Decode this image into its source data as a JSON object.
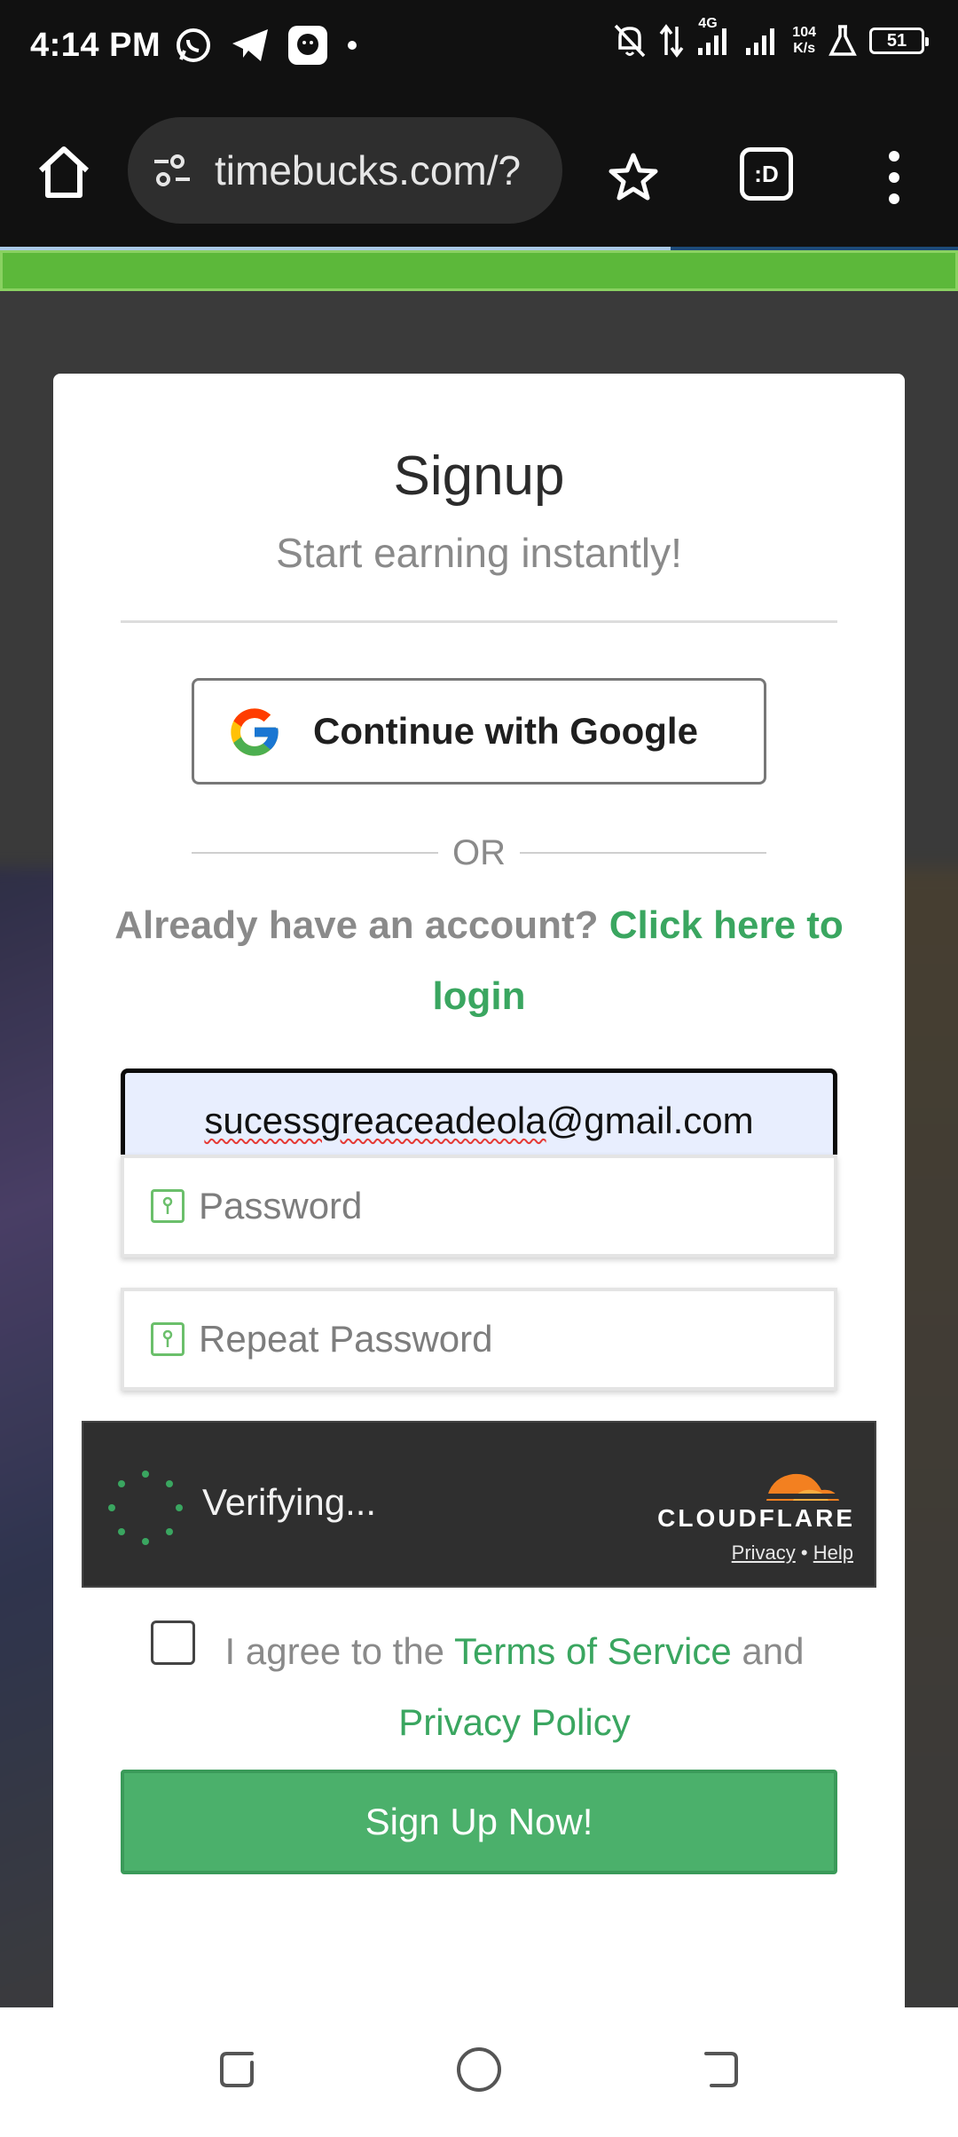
{
  "status_bar": {
    "time": "4:14 PM",
    "network": "4G",
    "net_speed_value": "104",
    "net_speed_unit": "K/s",
    "battery": "51",
    "icons": [
      "whatsapp-icon",
      "telegram-icon",
      "app-icon",
      "dot-icon",
      "bell-off-icon",
      "data-transfer-icon",
      "signal-icon",
      "signal-icon-2",
      "lab-icon",
      "battery-icon"
    ]
  },
  "browser": {
    "url": "timebucks.com/?",
    "tab_switcher_label": ":D"
  },
  "colors": {
    "accent_green": "#3aa660",
    "button_green": "#4bb06b",
    "banner_green": "#5cb83a",
    "cloudflare_orange": "#f38020"
  },
  "signup": {
    "title": "Signup",
    "subtitle": "Start earning instantly!",
    "google_button": "Continue with Google",
    "or": "OR",
    "already_account": "Already have an account?",
    "login_link": "Click here to login",
    "email_value_misspelled": "sucessgreaceadeola",
    "email_value_rest": "@gmail.com",
    "password_placeholder": "Password",
    "repeat_password_placeholder": "Repeat Password",
    "agree_prefix": "I agree to the",
    "terms_link": "Terms of Service",
    "agree_and": "and",
    "privacy_link": "Privacy Policy",
    "submit": "Sign Up Now!"
  },
  "cloudflare": {
    "status": "Verifying...",
    "brand": "CLOUDFLARE",
    "privacy": "Privacy",
    "separator": "•",
    "help": "Help"
  }
}
